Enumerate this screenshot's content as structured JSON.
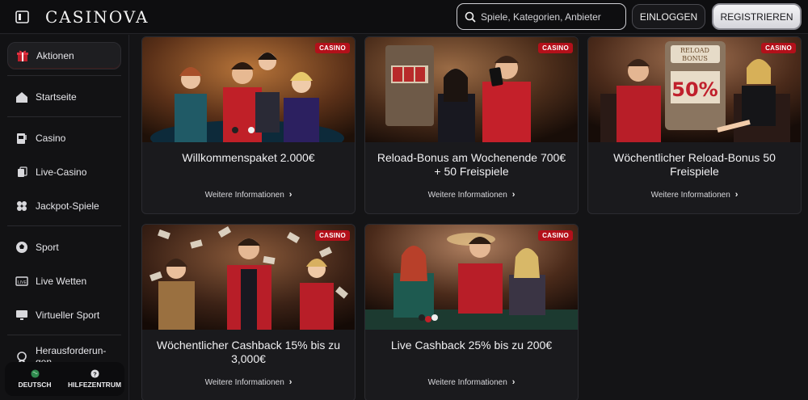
{
  "header": {
    "logo": "CASINOVA",
    "search_placeholder": "Spiele, Kategorien, Anbieter",
    "login_label": "EINLOGGEN",
    "register_label": "REGISTRIEREN"
  },
  "sidebar": {
    "items": [
      {
        "label": "Aktionen",
        "icon": "gift-icon",
        "active": true
      },
      {
        "label": "Startseite",
        "icon": "home-icon"
      },
      {
        "label": "Casino",
        "icon": "slot-machine-icon"
      },
      {
        "label": "Live-Casino",
        "icon": "live-cards-icon"
      },
      {
        "label": "Jackpot-Spiele",
        "icon": "clover-icon"
      },
      {
        "label": "Sport",
        "icon": "soccer-ball-icon"
      },
      {
        "label": "Live Wetten",
        "icon": "live-tv-icon"
      },
      {
        "label": "Virtueller Sport",
        "icon": "monitor-icon"
      },
      {
        "label": "Herausforderun-gen",
        "icon": "medal-icon"
      }
    ],
    "footer": {
      "language_label": "DEUTSCH",
      "help_label": "HILFEZENTRUM"
    }
  },
  "promotions": [
    {
      "title": "Willkommenspaket 2.000€",
      "badge": "CASINO",
      "more": "Weitere Informationen"
    },
    {
      "title": "Reload-Bonus am Wochenende 700€ + 50 Freispiele",
      "badge": "CASINO",
      "more": "Weitere Informationen"
    },
    {
      "title": "Wöchentlicher Reload-Bonus 50 Freispiele",
      "badge": "CASINO",
      "more": "Weitere Informationen",
      "image_text": "RELOAD BONUS",
      "image_number": "50%"
    },
    {
      "title": "Wöchentlicher Cashback 15% bis zu 3,000€",
      "badge": "CASINO",
      "more": "Weitere Informationen"
    },
    {
      "title": "Live Cashback 25% bis zu 200€",
      "badge": "CASINO",
      "more": "Weitere Informationen"
    }
  ],
  "colors": {
    "background": "#141416",
    "badge": "#b3101a",
    "accent_red": "#c0202c"
  }
}
